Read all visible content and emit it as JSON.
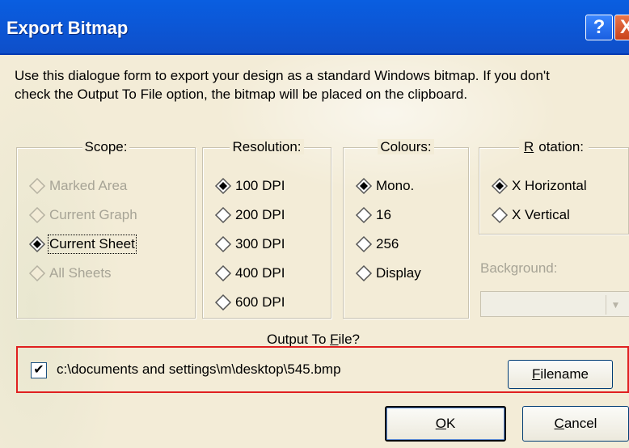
{
  "window": {
    "title": "Export Bitmap",
    "help_label": "?",
    "close_label": "X"
  },
  "description": {
    "line1": "Use this dialogue form to export your design as a standard Windows bitmap. If you don't",
    "line2": "check the Output To File option, the bitmap will be placed on the clipboard."
  },
  "scope": {
    "title": "Scope:",
    "options": [
      {
        "label": "Marked Area",
        "selected": false,
        "enabled": false
      },
      {
        "label": "Current Graph",
        "selected": false,
        "enabled": false
      },
      {
        "label": "Current Sheet",
        "selected": true,
        "enabled": true
      },
      {
        "label": "All Sheets",
        "selected": false,
        "enabled": false
      }
    ]
  },
  "resolution": {
    "title": "Resolution:",
    "options": [
      {
        "label": "100 DPI",
        "selected": true
      },
      {
        "label": "200 DPI",
        "selected": false
      },
      {
        "label": "300 DPI",
        "selected": false
      },
      {
        "label": "400 DPI",
        "selected": false
      },
      {
        "label": "600 DPI",
        "selected": false
      }
    ]
  },
  "colours": {
    "title": "Colours:",
    "options": [
      {
        "label": "Mono.",
        "selected": true
      },
      {
        "label": "16",
        "selected": false
      },
      {
        "label": "256",
        "selected": false
      },
      {
        "label": "Display",
        "selected": false
      }
    ]
  },
  "rotation": {
    "title_prefix": "",
    "title_underlined": "R",
    "title_rest": "otation:",
    "options": [
      {
        "label": "X Horizontal",
        "selected": true
      },
      {
        "label": "X Vertical",
        "selected": false
      }
    ]
  },
  "background": {
    "label": "Background:",
    "value": ""
  },
  "output": {
    "title_prefix": "Output To ",
    "title_underlined": "F",
    "title_rest": "ile?",
    "checked": true,
    "check_glyph": "✔",
    "path": "c:\\documents and settings\\m\\desktop\\545.bmp",
    "filename_underlined": "F",
    "filename_rest": "ilename"
  },
  "buttons": {
    "ok_underlined": "O",
    "ok_rest": "K",
    "cancel_underlined": "C",
    "cancel_rest": "ancel"
  },
  "colors": {
    "title_bar": "#0b58d8",
    "highlight_border": "#e02020",
    "disabled_text": "#a7a496"
  }
}
